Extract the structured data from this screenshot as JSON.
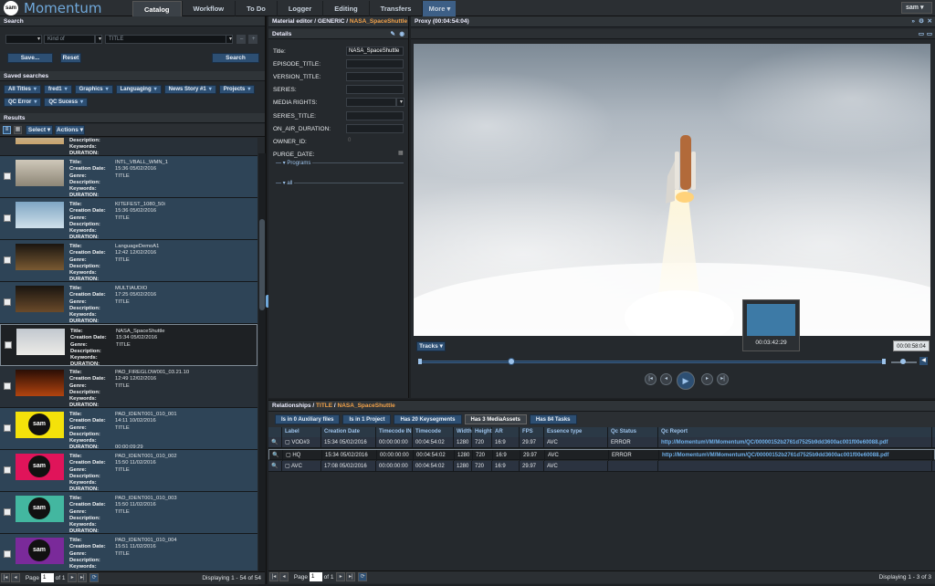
{
  "app": {
    "logo": "sam",
    "title": "Momentum",
    "user": "sam"
  },
  "nav": {
    "tabs": [
      "Catalog",
      "Workflow",
      "To Do",
      "Logger",
      "Editing",
      "Transfers"
    ],
    "more": "More"
  },
  "search": {
    "header": "Search",
    "kind_placeholder": "Kind of",
    "title_placeholder": "TITLE",
    "save": "Save...",
    "reset": "Reset",
    "search": "Search"
  },
  "saved": {
    "header": "Saved searches",
    "chips": [
      "All Titles",
      "fred1",
      "Graphics",
      "Languaging",
      "News Story #1",
      "Projects",
      "QC Error",
      "QC Sucess"
    ]
  },
  "results": {
    "header": "Results",
    "select": "Select",
    "actions": "Actions",
    "labels": [
      "Title:",
      "Creation Date:",
      "Genre:",
      "Description:",
      "Keywords:",
      "DURATION:"
    ],
    "rows": [
      {
        "title": "",
        "date": "",
        "genre": "TITLE",
        "duration": ""
      },
      {
        "title": "INTL_VBALL_WMN_1",
        "date": "15:36 05/02/2016",
        "genre": "TITLE",
        "duration": ""
      },
      {
        "title": "KITEFEST_1080_50i",
        "date": "15:36 05/02/2016",
        "genre": "TITLE",
        "duration": ""
      },
      {
        "title": "LanguageDemoA1",
        "date": "12:42 12/02/2016",
        "genre": "TITLE",
        "duration": ""
      },
      {
        "title": "MULTIAUDIO",
        "date": "17:25 05/02/2016",
        "genre": "TITLE",
        "duration": ""
      },
      {
        "title": "NASA_SpaceShuttle",
        "date": "15:34 05/02/2016",
        "genre": "TITLE",
        "duration": ""
      },
      {
        "title": "PAD_FIREGLOW001_03.21.10",
        "date": "12:49 12/02/2016",
        "genre": "TITLE",
        "duration": ""
      },
      {
        "title": "PAD_IDENT001_010_001",
        "date": "14:11 10/02/2016",
        "genre": "TITLE",
        "duration": "00:00:09:29"
      },
      {
        "title": "PAD_IDENT001_010_002",
        "date": "15:50 11/02/2016",
        "genre": "TITLE",
        "duration": ""
      },
      {
        "title": "PAD_IDENT001_010_003",
        "date": "15:50 11/02/2016",
        "genre": "TITLE",
        "duration": ""
      },
      {
        "title": "PAD_IDENT001_010_004",
        "date": "15:51 11/02/2016",
        "genre": "TITLE",
        "duration": ""
      }
    ],
    "footer": {
      "page_label": "Page",
      "page": "1",
      "of": "of 1",
      "displaying": "Displaying 1 - 54 of 54"
    }
  },
  "editor": {
    "header_prefix": "Material editor / GENERIC /",
    "header_name": "NASA_SpaceShuttle",
    "sub": "Details",
    "fields": [
      {
        "label": "Title:",
        "value": "NASA_SpaceShuttle"
      },
      {
        "label": "EPISODE_TITLE:",
        "value": ""
      },
      {
        "label": "VERSION_TITLE:",
        "value": ""
      },
      {
        "label": "SERIES:",
        "value": ""
      },
      {
        "label": "MEDIA RIGHTS:",
        "value": ""
      },
      {
        "label": "SERIES_TITLE:",
        "value": ""
      },
      {
        "label": "ON_AIR_DURATION:",
        "value": ""
      },
      {
        "label": "OWNER_ID:",
        "value": "0"
      },
      {
        "label": "PURGE_DATE:",
        "value": ""
      }
    ],
    "programs": "Programs",
    "all": "all"
  },
  "proxy": {
    "header": "Proxy (00:04:54:04)",
    "tracks": "Tracks",
    "thumb_time": "00:03:42:29",
    "timecode": "00:00:58:04"
  },
  "relationships": {
    "header_prefix": "Relationships /",
    "header_kind": "TITLE",
    "header_name": "NASA_SpaceShuttle",
    "tabs": [
      "Is in 0 Auxiliary files",
      "Is in 1 Project",
      "Has 20 Keysegments",
      "Has 3 MediaAssets",
      "Has 84 Tasks"
    ],
    "columns": [
      "Label",
      "Creation Date",
      "Timecode IN",
      "Timecode OUT",
      "Width",
      "Height",
      "AR",
      "FPS",
      "Essence type",
      "Qc Status",
      "Qc Report"
    ],
    "rows": [
      [
        "VOD#3",
        "15:34 05/02/2016",
        "00:00:00:00",
        "00:04:54:02",
        "1280",
        "720",
        "16:9",
        "29.97",
        "AVC",
        "ERROR",
        "http://MomentumVM/Momentum/QC/00000152b2761d7525b9dd3600ac001f00e60088.pdf"
      ],
      [
        "HQ",
        "15:34 05/02/2016",
        "00:00:00:00",
        "00:04:54:02",
        "1280",
        "720",
        "16:9",
        "29.97",
        "AVC",
        "ERROR",
        "http://MomentumVM/Momentum/QC/00000152b2761d7525b9dd3600ac001f00e60088.pdf"
      ],
      [
        "AVC",
        "17:08 05/02/2016",
        "00:00:00:00",
        "00:04:54:02",
        "1280",
        "720",
        "16:9",
        "29.97",
        "AVC",
        "",
        ""
      ]
    ],
    "footer": {
      "page_label": "Page",
      "page": "1",
      "of": "of 1",
      "displaying": "Displaying 1 - 3 of 3"
    }
  },
  "colors": {
    "accent": "#2d4f73",
    "highlight": "#f2a24a",
    "link": "#6fb0ea"
  }
}
